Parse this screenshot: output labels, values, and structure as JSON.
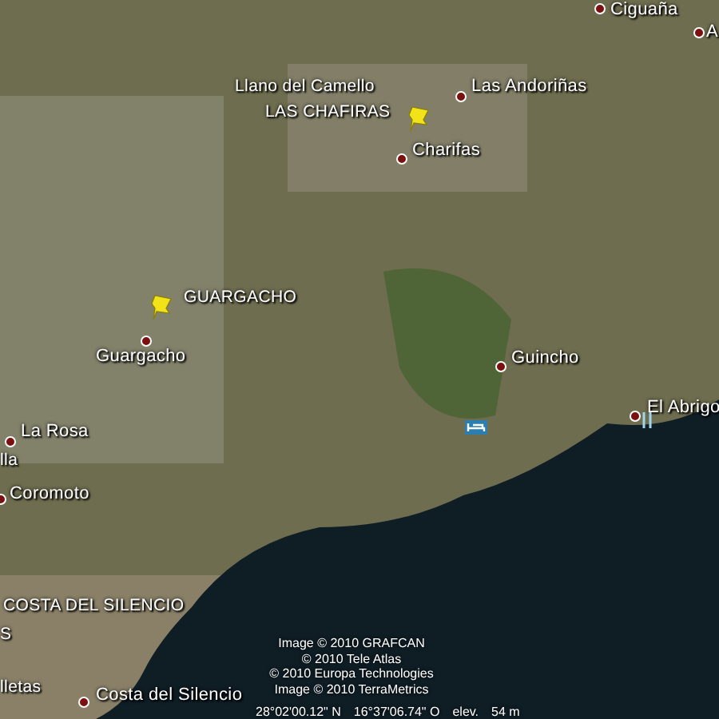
{
  "map": {
    "labels": [
      {
        "text": "Ciguaña",
        "kind": "town"
      },
      {
        "text": "A",
        "kind": "town"
      },
      {
        "text": "Llano del Camello",
        "kind": "region"
      },
      {
        "text": "Las Andoriñas",
        "kind": "town"
      },
      {
        "text": "LAS CHAFIRAS",
        "kind": "region"
      },
      {
        "text": "Charifas",
        "kind": "town"
      },
      {
        "text": "GUARGACHO",
        "kind": "region"
      },
      {
        "text": "Guargacho",
        "kind": "town"
      },
      {
        "text": "Guincho",
        "kind": "town"
      },
      {
        "text": "El Abrigo",
        "kind": "town"
      },
      {
        "text": "La Rosa",
        "kind": "town"
      },
      {
        "text": "lla",
        "kind": "region"
      },
      {
        "text": "Coromoto",
        "kind": "town"
      },
      {
        "text": "COSTA DEL SILENCIO",
        "kind": "region"
      },
      {
        "text": "S",
        "kind": "region"
      },
      {
        "text": "lletas",
        "kind": "region"
      },
      {
        "text": "Costa del Silencio",
        "kind": "town"
      }
    ]
  },
  "attribution": [
    "Image © 2010 GRAFCAN",
    "© 2010 Tele Atlas",
    "© 2010 Europa Technologies",
    "Image © 2010 TerraMetrics"
  ],
  "status": {
    "latitude": "28°02'00.12\" N",
    "longitude": "16°37'06.74\" O",
    "elevation_label": "elev.",
    "elevation": "54 m"
  }
}
